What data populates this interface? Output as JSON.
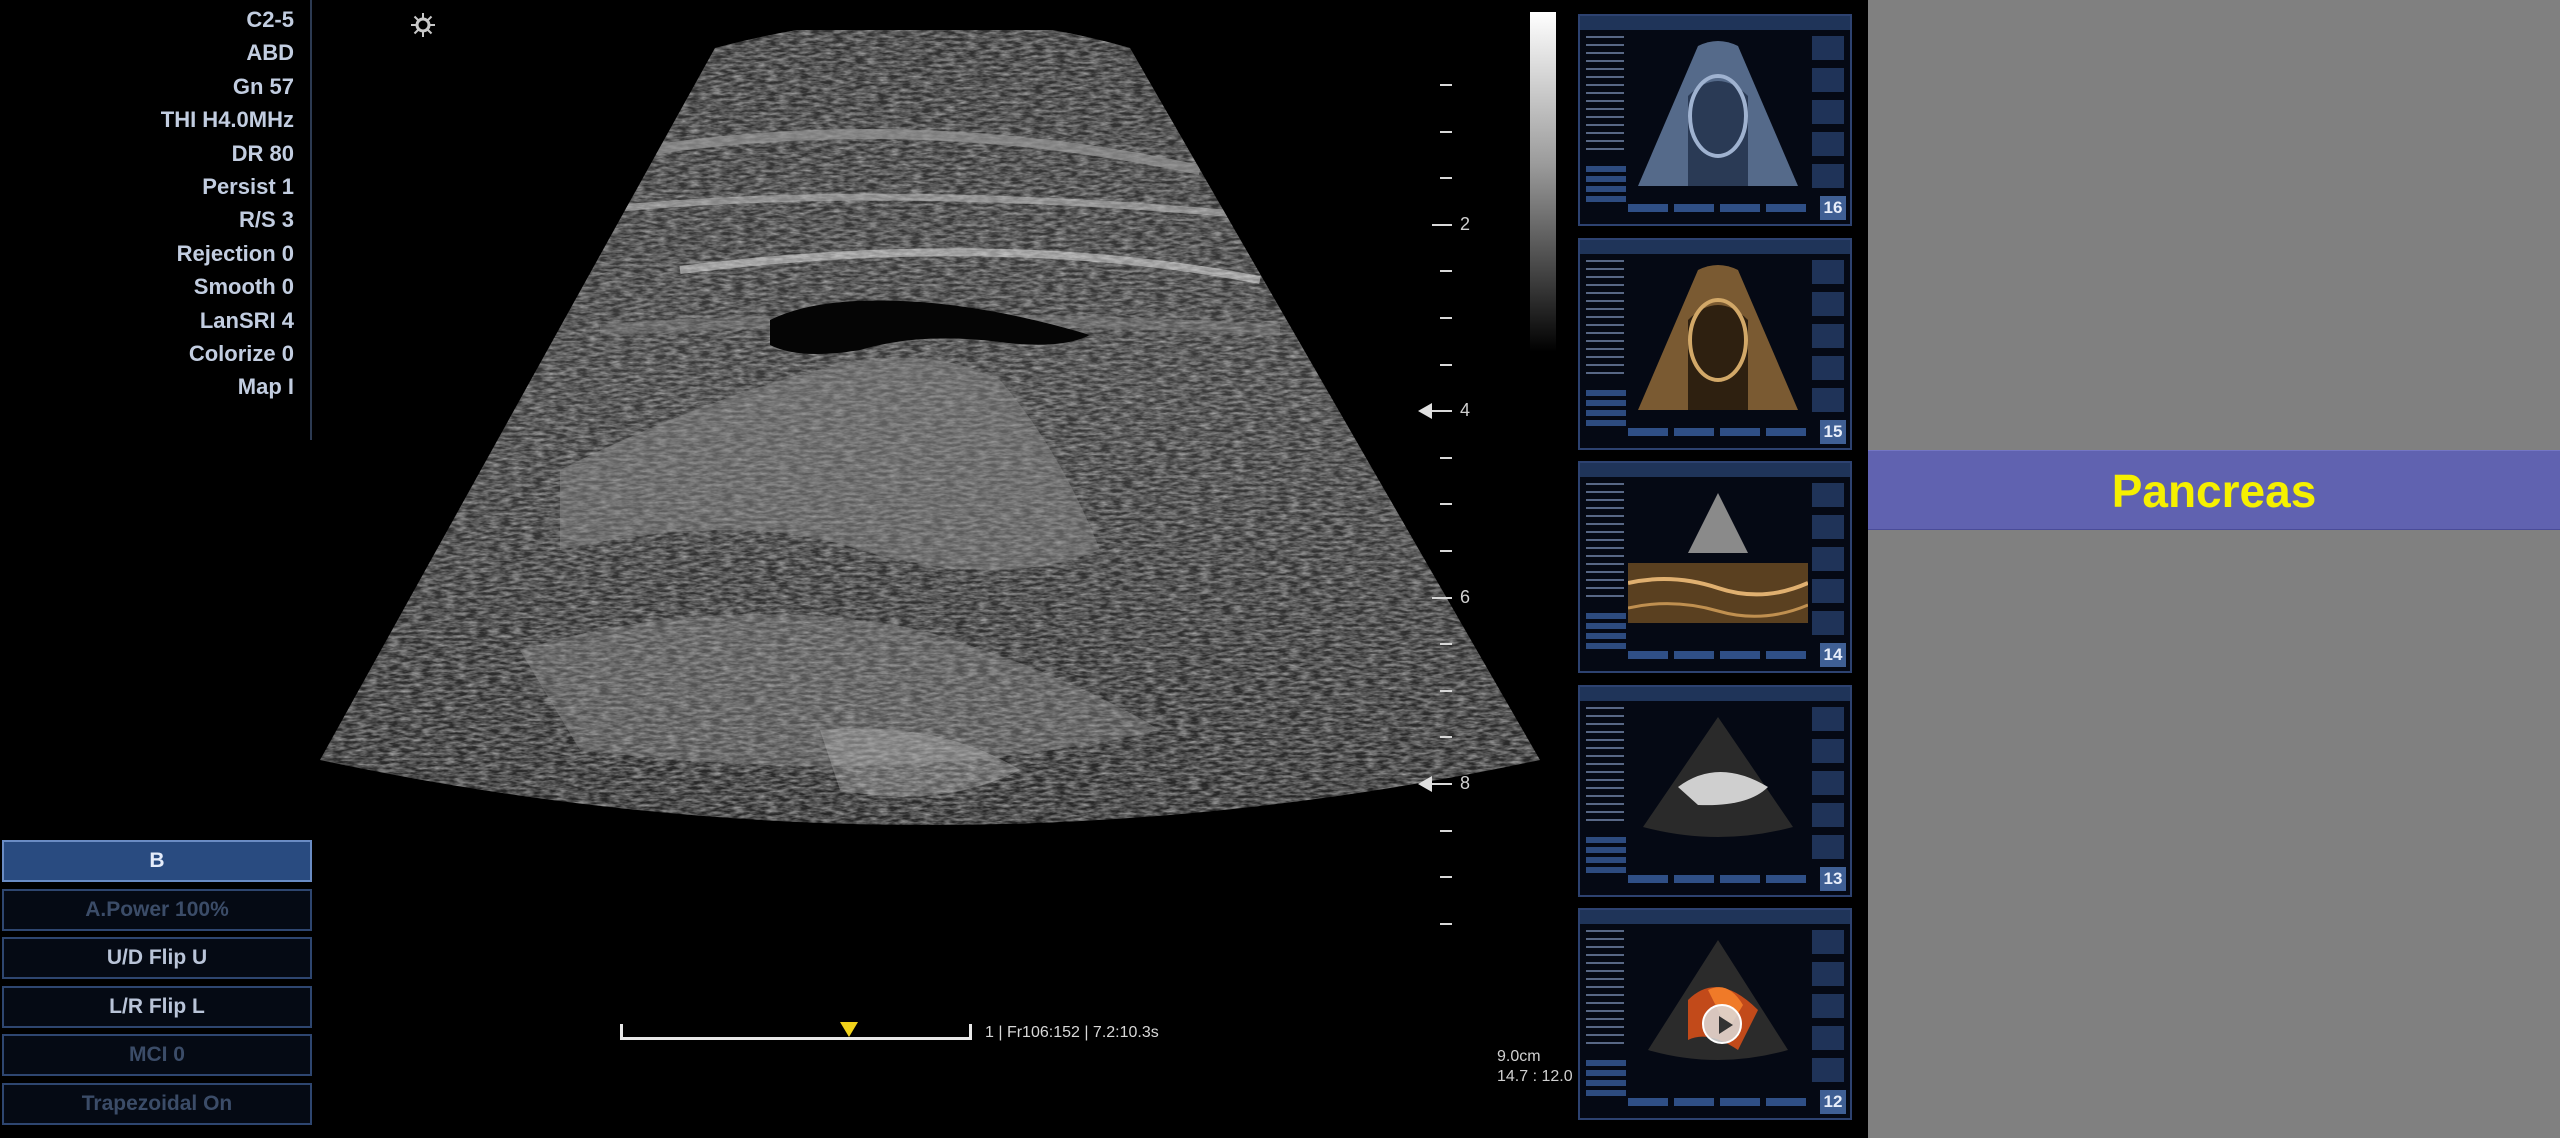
{
  "params": [
    "C2-5",
    "ABD",
    "Gn 57",
    "THI H4.0MHz",
    "DR 80",
    "Persist 1",
    "R/S 3",
    "Rejection 0",
    "Smooth 0",
    "LanSRI 4",
    "Colorize 0",
    "Map I"
  ],
  "menu": [
    {
      "label": "B",
      "state": "active"
    },
    {
      "label": "A.Power 100%",
      "state": "dim"
    },
    {
      "label": "U/D Flip  U",
      "state": "normal"
    },
    {
      "label": "L/R Flip  L",
      "state": "normal"
    },
    {
      "label": "MCI 0",
      "state": "dim"
    },
    {
      "label": "Trapezoidal  On",
      "state": "dim"
    }
  ],
  "depth_labels": [
    "2",
    "4",
    "6",
    "8"
  ],
  "cine": {
    "text": "1 | Fr106:152 | 7.2:10.3s",
    "position": 0.65
  },
  "readout": {
    "depth": "9.0cm",
    "ratio": "14.7 : 12.0"
  },
  "thumbnails": [
    {
      "number": "16",
      "kind": "gray"
    },
    {
      "number": "15",
      "kind": "sepia"
    },
    {
      "number": "14",
      "kind": "mmode"
    },
    {
      "number": "13",
      "kind": "cardiac"
    },
    {
      "number": "12",
      "kind": "color"
    }
  ],
  "title": "Pancreas",
  "colors": {
    "title_text": "#f6f000",
    "banner": "#6062b0",
    "panel": "#808080",
    "cine_marker": "#f0d21a"
  }
}
